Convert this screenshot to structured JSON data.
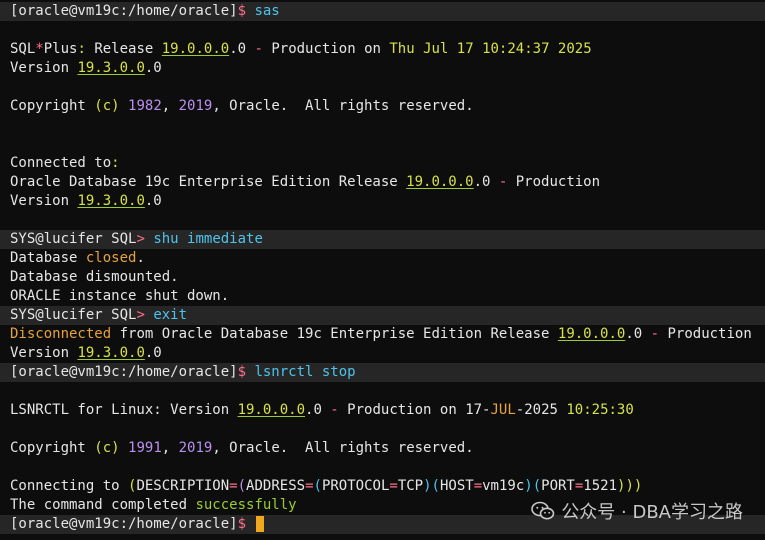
{
  "prompt": {
    "user": "[oracle@vm19c:/home/oracle]",
    "symbol": "$"
  },
  "commands": {
    "sas": "sas",
    "shutdown": "shu immediate",
    "exit": "exit",
    "lsnr": "lsnrctl stop"
  },
  "sql_prompt": {
    "user": "SYS@lucifer",
    "sql": "SQL",
    "gt": ">"
  },
  "sqlplus_banner": {
    "prefix": "SQL",
    "star": "*",
    "word_plus": "Plus",
    "colon": ":",
    "release_word": " Release ",
    "release_hl": "19.0.0.0",
    "release_tail": ".0",
    "dash": " - ",
    "production": "Production",
    "on_word": " on ",
    "date": "Thu Jul 17 10:24:37 2025"
  },
  "version_line": {
    "label": "Version ",
    "hl": "19.3.0.0",
    "tail": ".0"
  },
  "copyright1": {
    "label": "Copyright ",
    "c": "(c)",
    "year1": "1982",
    "comma": ", ",
    "year2": "2019",
    "tail": ", Oracle.  All rights reserved."
  },
  "connected": {
    "label": "Connected to",
    "colon": ":"
  },
  "db_edition": {
    "text": "Oracle Database 19c Enterprise Edition Release ",
    "hl": "19.0.0.0",
    "tail": ".0",
    "dash": " - ",
    "production": "Production"
  },
  "shutdown_output": {
    "line1_a": "Database ",
    "line1_b": "closed",
    "line1_c": ".",
    "line2": "Database dismounted.",
    "line3": "ORACLE instance shut down."
  },
  "disconnected": {
    "word": "Disconnected",
    "text": " from Oracle Database 19c Enterprise Edition Release ",
    "hl": "19.0.0.0",
    "tail": ".0",
    "dash": " - ",
    "production": "Production"
  },
  "lsnrctl_banner": {
    "text": "LSNRCTL for Linux: Version ",
    "hl": "19.0.0.0",
    "tail": ".0",
    "dash": " - ",
    "production": "Production",
    "on_word": " on ",
    "date_a": "17-",
    "date_b": "JUL",
    "date_c": "-2025 ",
    "time": "10:25:30"
  },
  "copyright2": {
    "label": "Copyright ",
    "c": "(c)",
    "year1": "1991",
    "comma": ", ",
    "year2": "2019",
    "tail": ", Oracle.  All rights reserved."
  },
  "connecting": {
    "label": "Connecting to ",
    "p1": "(",
    "desc": "DESCRIPTION",
    "eq1": "=",
    "p2": "(",
    "addr": "ADDRESS",
    "eq2": "=",
    "p3": "(",
    "proto": "PROTOCOL",
    "eq3": "=",
    "tcp": "TCP",
    "p4": ")(",
    "host": "HOST",
    "eq4": "=",
    "hostval": "vm19c",
    "p5": ")(",
    "port": "PORT",
    "eq5": "=",
    "portval": "1521",
    "p6": ")))"
  },
  "completed": {
    "text": "The command completed ",
    "word": "successfully"
  },
  "watermark": {
    "text": "公众号 · DBA学习之路",
    "icon": "wechat-icon"
  },
  "colors": {
    "background": "#0d0d0d",
    "highlight_row": "#262626",
    "cursor": "#f0a81e"
  }
}
